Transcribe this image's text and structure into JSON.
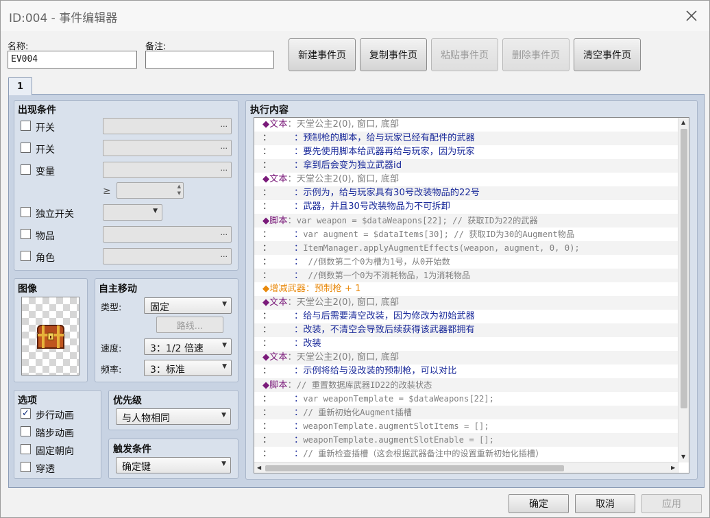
{
  "window": {
    "title": "ID:004 - 事件编辑器"
  },
  "fields": {
    "name_label": "名称:",
    "name_value": "EV004",
    "note_label": "备注:",
    "note_value": ""
  },
  "toolbar": {
    "new_page": "新建事件页",
    "copy_page": "复制事件页",
    "paste_page": "粘贴事件页",
    "delete_page": "删除事件页",
    "clear_page": "清空事件页"
  },
  "tabs": [
    "1"
  ],
  "conditions": {
    "title": "出现条件",
    "switch1": "开关",
    "switch2": "开关",
    "variable": "变量",
    "gte": "≥",
    "self_switch": "独立开关",
    "item": "物品",
    "actor": "角色",
    "dots": "..."
  },
  "image": {
    "title": "图像"
  },
  "autonomous": {
    "title": "自主移动",
    "type_label": "类型:",
    "type_value": "固定",
    "route_button": "路线...",
    "speed_label": "速度:",
    "speed_value": "3：1/2 倍速",
    "freq_label": "频率:",
    "freq_value": "3：标准"
  },
  "options": {
    "title": "选项",
    "items": [
      {
        "label": "步行动画",
        "checked": true
      },
      {
        "label": "踏步动画",
        "checked": false
      },
      {
        "label": "固定朝向",
        "checked": false
      },
      {
        "label": "穿透",
        "checked": false
      }
    ]
  },
  "priority": {
    "title": "优先级",
    "value": "与人物相同"
  },
  "trigger": {
    "title": "触发条件",
    "value": "确定键"
  },
  "contents": {
    "title": "执行内容",
    "rows": [
      {
        "kind": "head",
        "head": "◆文本",
        "sep": "：",
        "text": "天堂公主2(0), 窗口, 底部",
        "cls": "gray"
      },
      {
        "kind": "cont",
        "head": "：",
        "sep": "：",
        "text": "预制枪的脚本，给与玩家已经有配件的武器",
        "cls": "blue"
      },
      {
        "kind": "cont",
        "head": "：",
        "sep": "：",
        "text": "要先使用脚本给武器再给与玩家，因为玩家",
        "cls": "blue"
      },
      {
        "kind": "cont",
        "head": "：",
        "sep": "：",
        "text": "拿到后会变为独立武器id",
        "cls": "blue"
      },
      {
        "kind": "head",
        "head": "◆文本",
        "sep": "：",
        "text": "天堂公主2(0), 窗口, 底部",
        "cls": "gray"
      },
      {
        "kind": "cont",
        "head": "：",
        "sep": "：",
        "text": "示例为，给与玩家具有30号改装物品的22号",
        "cls": "blue"
      },
      {
        "kind": "cont",
        "head": "：",
        "sep": "：",
        "text": "武器，并且30号改装物品为不可拆卸",
        "cls": "blue"
      },
      {
        "kind": "head",
        "head": "◆脚本",
        "sep": "：",
        "text": "var weapon = $dataWeapons[22]; // 获取ID为22的武器",
        "cls": "gray mono"
      },
      {
        "kind": "cont",
        "head": "：",
        "sep": "：",
        "text": "var augment = $dataItems[30];  // 获取ID为30的Augment物品",
        "cls": "gray mono"
      },
      {
        "kind": "cont",
        "head": "：",
        "sep": "：",
        "text": "ItemManager.applyAugmentEffects(weapon, augment, 0, 0);",
        "cls": "gray mono"
      },
      {
        "kind": "cont",
        "head": "：",
        "sep": "：",
        "text": " //倒数第二个0为槽为1号，从0开始数",
        "cls": "gray mono"
      },
      {
        "kind": "cont",
        "head": "：",
        "sep": "：",
        "text": " //倒数第一个0为不消耗物品，1为消耗物品",
        "cls": "gray mono"
      },
      {
        "kind": "orange",
        "head": "◆增减武器",
        "sep": "：",
        "text": "预制枪 + 1",
        "cls": "orangetext"
      },
      {
        "kind": "head",
        "head": "◆文本",
        "sep": "：",
        "text": "天堂公主2(0), 窗口, 底部",
        "cls": "gray"
      },
      {
        "kind": "cont",
        "head": "：",
        "sep": "：",
        "text": "给与后需要清空改装，因为修改为初始武器",
        "cls": "blue"
      },
      {
        "kind": "cont",
        "head": "：",
        "sep": "：",
        "text": "改装，不清空会导致后续获得该武器都拥有",
        "cls": "blue"
      },
      {
        "kind": "cont",
        "head": "：",
        "sep": "：",
        "text": "改装",
        "cls": "blue"
      },
      {
        "kind": "head",
        "head": "◆文本",
        "sep": "：",
        "text": "天堂公主2(0), 窗口, 底部",
        "cls": "gray"
      },
      {
        "kind": "cont",
        "head": "：",
        "sep": "：",
        "text": "示例将给与没改装的预制枪，可以对比",
        "cls": "blue"
      },
      {
        "kind": "head",
        "head": "◆脚本",
        "sep": "：",
        "text": "// 重置数据库武器ID22的改装状态",
        "cls": "gray mono"
      },
      {
        "kind": "cont",
        "head": "：",
        "sep": "：",
        "text": "var weaponTemplate = $dataWeapons[22];",
        "cls": "gray mono"
      },
      {
        "kind": "cont",
        "head": "：",
        "sep": "：",
        "text": "// 重新初始化Augment插槽",
        "cls": "gray mono"
      },
      {
        "kind": "cont",
        "head": "：",
        "sep": "：",
        "text": "weaponTemplate.augmentSlotItems = [];",
        "cls": "gray mono"
      },
      {
        "kind": "cont",
        "head": "：",
        "sep": "：",
        "text": "weaponTemplate.augmentSlotEnable = [];",
        "cls": "gray mono"
      },
      {
        "kind": "cont",
        "head": "：",
        "sep": "：",
        "text": "// 重新检查插槽（这会根据武器备注中的设置重新初始化插槽）",
        "cls": "gray mono"
      }
    ]
  },
  "footer": {
    "ok": "确定",
    "cancel": "取消",
    "apply": "应用"
  },
  "colors": {
    "panel": "#c8d3e3",
    "group": "#d9e1ec",
    "command_head": "#7a1a7a",
    "text_blue": "#1a2a9a",
    "orange": "#e8890c"
  },
  "icons": [
    "close-icon",
    "chest-icon",
    "checkmark-icon",
    "dropdown-arrow-icon",
    "scroll-arrow-icon"
  ]
}
